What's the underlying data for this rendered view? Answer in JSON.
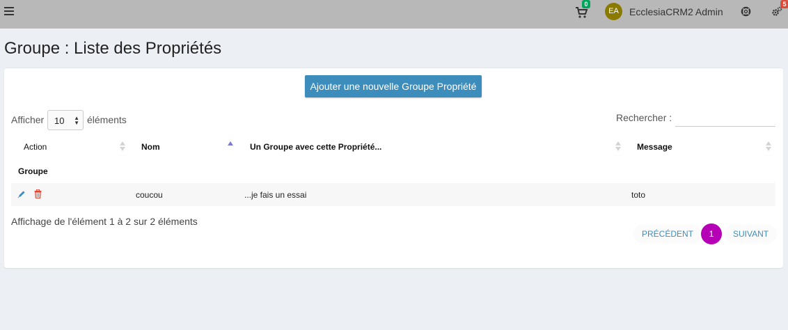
{
  "topbar": {
    "cart_count": "0",
    "user_initials": "EA",
    "user_name": "EcclesiaCRM2 Admin",
    "notification_count": "5",
    "icons": [
      "menu-icon",
      "cart-icon",
      "lifebuoy-icon",
      "gears-icon"
    ]
  },
  "page": {
    "title": "Groupe : Liste des Propriétés"
  },
  "toolbar": {
    "add_label": "Ajouter une nouvelle Groupe Propriété"
  },
  "length": {
    "prefix": "Afficher",
    "value": "10",
    "suffix": "éléments"
  },
  "search": {
    "label": "Rechercher :",
    "value": ""
  },
  "table": {
    "columns": [
      "Action",
      "Nom",
      "Un Groupe avec cette Propriété...",
      "Message"
    ],
    "group_label": "Groupe",
    "rows": [
      {
        "name": "coucou",
        "prompt": "...je fais un essai",
        "message": "toto"
      }
    ]
  },
  "footer": {
    "info": "Affichage de l'élément 1 à 2 sur 2 éléments"
  },
  "pagination": {
    "prev": "PRÉCÉDENT",
    "current": "1",
    "next": "SUIVANT"
  },
  "colors": {
    "primary": "#3c8dbc",
    "page_active": "#b600b6",
    "delete": "#dd4b39",
    "topbar": "#b8b8b8"
  }
}
